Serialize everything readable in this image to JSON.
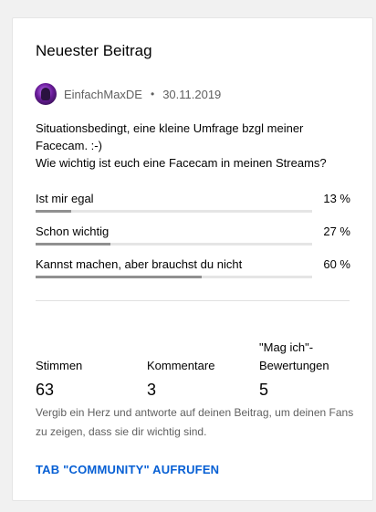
{
  "card": {
    "title": "Neuester Beitrag",
    "author": "EinfachMaxDE",
    "separator": "•",
    "date": "30.11.2019",
    "text_lines": [
      "Situationsbedingt, eine kleine Umfrage bzgl meiner",
      "Facecam. :-)",
      "Wie wichtig ist euch eine Facecam in meinen Streams?"
    ]
  },
  "poll": {
    "options": [
      {
        "label": "Ist mir egal",
        "percent_label": "13 %",
        "percent": 13
      },
      {
        "label": "Schon wichtig",
        "percent_label": "27 %",
        "percent": 27
      },
      {
        "label": "Kannst machen, aber brauchst du nicht",
        "percent_label": "60 %",
        "percent": 60
      }
    ]
  },
  "stats": {
    "votes_label": "Stimmen",
    "votes_value": "63",
    "comments_label": "Kommentare",
    "comments_value": "3",
    "likes_label": "\"Mag ich\"-Bewertungen",
    "likes_value": "5"
  },
  "note": "Vergib ein Herz und antworte auf deinen Beitrag, um deinen Fans zu zeigen, dass sie dir wichtig sind.",
  "link_label": "TAB \"COMMUNITY\" AUFRUFEN",
  "colors": {
    "accent": "#065fd4",
    "bar_fill": "#909090",
    "bar_track": "#e5e5e5"
  }
}
